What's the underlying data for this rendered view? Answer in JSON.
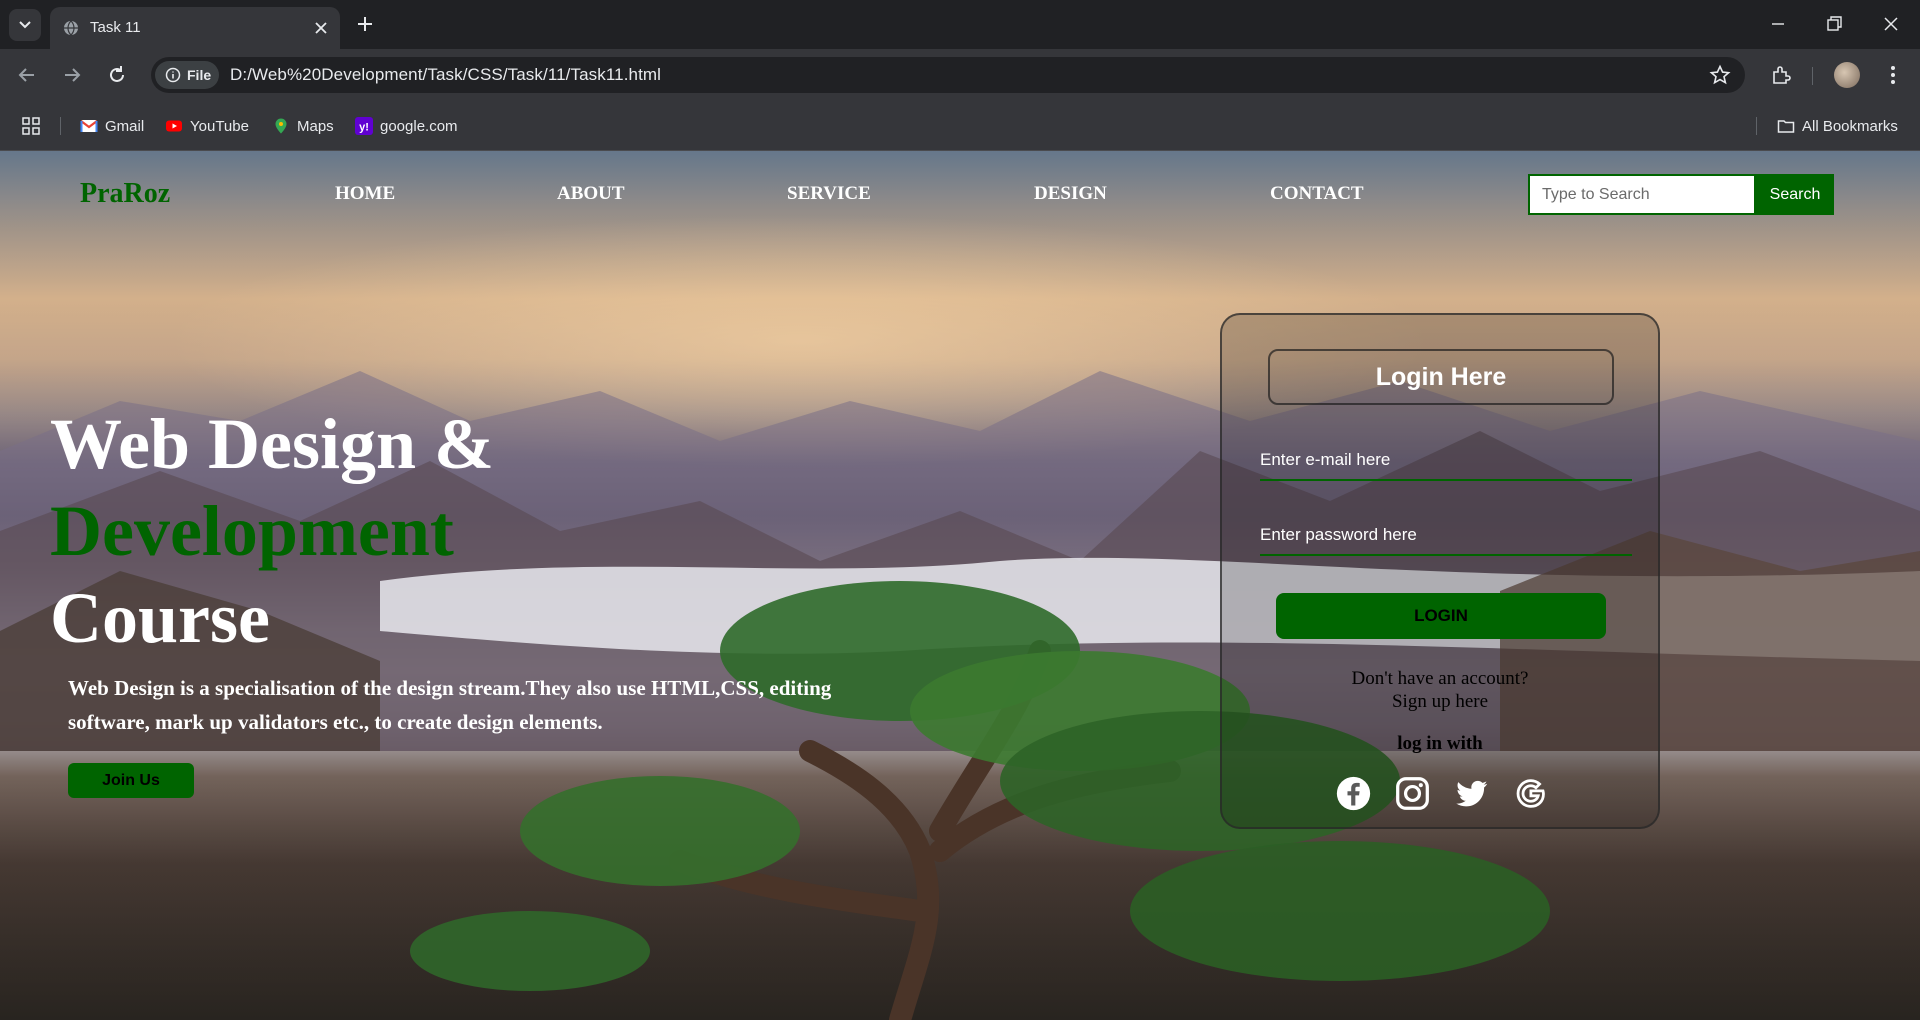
{
  "browser": {
    "tab_title": "Task 11",
    "site_chip": "File",
    "url": "D:/Web%20Development/Task/CSS/Task/11/Task11.html",
    "bookmarks": [
      "Gmail",
      "YouTube",
      "Maps",
      "google.com"
    ],
    "all_bookmarks": "All Bookmarks"
  },
  "page": {
    "brand": "PraRoz",
    "nav": [
      "HOME",
      "ABOUT",
      "SERVICE",
      "DESIGN",
      "CONTACT"
    ],
    "search": {
      "placeholder": "Type to Search",
      "button": "Search"
    },
    "hero": {
      "line1": "Web Design &",
      "line2": "Development",
      "line3": "Course",
      "description": "Web Design is a specialisation of the design stream.They also use HTML,CSS, editing software, mark up validators etc., to create design elements.",
      "cta": "Join Us"
    },
    "login": {
      "title": "Login Here",
      "email_placeholder": "Enter e-mail here",
      "password_placeholder": "Enter password here",
      "button": "LOGIN",
      "no_account": "Don't have an account?",
      "signup": "Sign up here",
      "login_with": "log in with",
      "social_icons": [
        "facebook-icon",
        "instagram-icon",
        "twitter-icon",
        "google-icon"
      ]
    },
    "colors": {
      "accent_green": "#006400"
    }
  }
}
